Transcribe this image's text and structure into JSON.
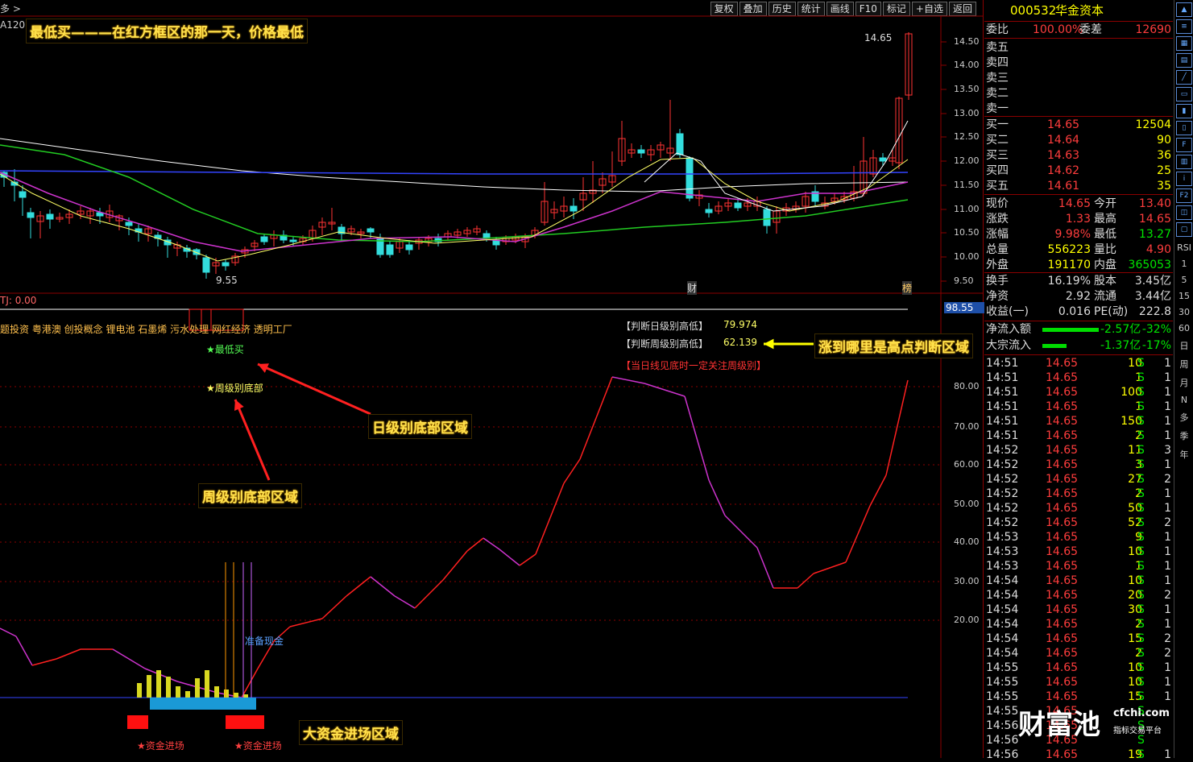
{
  "toolbar": [
    "复权",
    "叠加",
    "历史",
    "统计",
    "画线",
    "F10",
    "标记",
    "+自选",
    "返回"
  ],
  "chart_header": {
    "left_frag": "多 >",
    "ma_frag": "A120: 11.87",
    "tj": "TJ: 0.00"
  },
  "main_price_axis": [
    "14.50",
    "14.00",
    "13.50",
    "13.00",
    "12.50",
    "12.00",
    "11.50",
    "11.00",
    "10.50",
    "10.00",
    "9.50"
  ],
  "price_marks": {
    "high": "14.65",
    "low": "9.55",
    "cai": "财",
    "bang": "榜"
  },
  "indicator_axis": [
    "80.00",
    "70.00",
    "60.00",
    "50.00",
    "40.00",
    "30.00",
    "20.00"
  ],
  "indicator_current": "98.55",
  "concept_tags": "题投资 粤港澳 创投概念 锂电池 石墨烯 污水处理 网红经济 透明工厂",
  "labels": {
    "best_buy": "★最低买",
    "weekly_bottom": "★周级别底部",
    "judge_daily": "【判断日级别高低】",
    "judge_daily_val": "79.974",
    "judge_weekly": "【判断周级别高低】",
    "judge_weekly_val": "62.139",
    "notice": "【当日线见底时一定关注周级别】",
    "prepare_cash": "准备现金",
    "fund_in_1": "★资金进场",
    "fund_in_2": "★资金进场"
  },
  "annotations": {
    "title": "最低买———在红方框区的那一天，价格最低",
    "daily_bottom": "日级别底部区域",
    "weekly_bottom": "周级别底部区域",
    "high_judge": "涨到哪里是高点判断区域",
    "big_fund": "大资金进场区域"
  },
  "stock": {
    "code": "000532",
    "name": "华金资本"
  },
  "weibi": {
    "label": "委比",
    "value": "100.00%",
    "label2": "委差",
    "value2": "12690"
  },
  "sell": [
    {
      "label": "卖五",
      "price": "",
      "vol": ""
    },
    {
      "label": "卖四",
      "price": "",
      "vol": ""
    },
    {
      "label": "卖三",
      "price": "",
      "vol": ""
    },
    {
      "label": "卖二",
      "price": "",
      "vol": ""
    },
    {
      "label": "卖一",
      "price": "",
      "vol": ""
    }
  ],
  "buy": [
    {
      "label": "买一",
      "price": "14.65",
      "vol": "12504"
    },
    {
      "label": "买二",
      "price": "14.64",
      "vol": "90"
    },
    {
      "label": "买三",
      "price": "14.63",
      "vol": "36"
    },
    {
      "label": "买四",
      "price": "14.62",
      "vol": "25"
    },
    {
      "label": "买五",
      "price": "14.61",
      "vol": "35"
    }
  ],
  "quote": [
    {
      "l1": "现价",
      "v1": "14.65",
      "l2": "今开",
      "v2": "13.40"
    },
    {
      "l1": "涨跌",
      "v1": "1.33",
      "l2": "最高",
      "v2": "14.65"
    },
    {
      "l1": "涨幅",
      "v1": "9.98%",
      "l2": "最低",
      "v2": "13.27"
    },
    {
      "l1": "总量",
      "v1": "556223",
      "l2": "量比",
      "v2": "4.90"
    },
    {
      "l1": "外盘",
      "v1": "191170",
      "l2": "内盘",
      "v2": "365053"
    }
  ],
  "stats": [
    {
      "l1": "换手",
      "v1": "16.19%",
      "l2": "股本",
      "v2": "3.45亿"
    },
    {
      "l1": "净资",
      "v1": "2.92",
      "l2": "流通",
      "v2": "3.44亿"
    },
    {
      "l1": "收益(一)",
      "v1": "0.016",
      "l2": "PE(动)",
      "v2": "222.8"
    }
  ],
  "flows": [
    {
      "label": "净流入额",
      "value": "-2.57亿",
      "pct": "-32%"
    },
    {
      "label": "大宗流入",
      "value": "-1.37亿",
      "pct": "-17%"
    }
  ],
  "ticks": [
    [
      "14:51",
      "14.65",
      "10",
      "S",
      "1"
    ],
    [
      "14:51",
      "14.65",
      "1",
      "S",
      "1"
    ],
    [
      "14:51",
      "14.65",
      "100",
      "S",
      "1"
    ],
    [
      "14:51",
      "14.65",
      "1",
      "S",
      "1"
    ],
    [
      "14:51",
      "14.65",
      "150",
      "S",
      "1"
    ],
    [
      "14:51",
      "14.65",
      "2",
      "S",
      "1"
    ],
    [
      "14:52",
      "14.65",
      "11",
      "S",
      "3"
    ],
    [
      "14:52",
      "14.65",
      "3",
      "S",
      "1"
    ],
    [
      "14:52",
      "14.65",
      "27",
      "S",
      "2"
    ],
    [
      "14:52",
      "14.65",
      "2",
      "S",
      "1"
    ],
    [
      "14:52",
      "14.65",
      "50",
      "S",
      "1"
    ],
    [
      "14:52",
      "14.65",
      "52",
      "S",
      "2"
    ],
    [
      "14:53",
      "14.65",
      "9",
      "S",
      "1"
    ],
    [
      "14:53",
      "14.65",
      "10",
      "S",
      "1"
    ],
    [
      "14:53",
      "14.65",
      "1",
      "S",
      "1"
    ],
    [
      "14:54",
      "14.65",
      "10",
      "S",
      "1"
    ],
    [
      "14:54",
      "14.65",
      "20",
      "S",
      "2"
    ],
    [
      "14:54",
      "14.65",
      "30",
      "S",
      "1"
    ],
    [
      "14:54",
      "14.65",
      "2",
      "S",
      "1"
    ],
    [
      "14:54",
      "14.65",
      "15",
      "S",
      "2"
    ],
    [
      "14:54",
      "14.65",
      "2",
      "S",
      "2"
    ],
    [
      "14:55",
      "14.65",
      "10",
      "S",
      "1"
    ],
    [
      "14:55",
      "14.65",
      "10",
      "S",
      "1"
    ],
    [
      "14:55",
      "14.65",
      "15",
      "S",
      "1"
    ],
    [
      "14:55",
      "14.65",
      "",
      "S",
      ""
    ],
    [
      "14:56",
      "14.65",
      "",
      "S",
      ""
    ],
    [
      "14:56",
      "14.65",
      "",
      "S",
      ""
    ],
    [
      "14:56",
      "14.65",
      "19",
      "S",
      "1"
    ]
  ],
  "icon_bar": [
    "RSI",
    "1",
    "5",
    "15",
    "30",
    "60",
    "日",
    "周",
    "月",
    "N",
    "多",
    "季",
    "年"
  ],
  "watermark": {
    "brand": "财富池",
    "site": "cfchi.com",
    "sub": "指标交易平台"
  }
}
